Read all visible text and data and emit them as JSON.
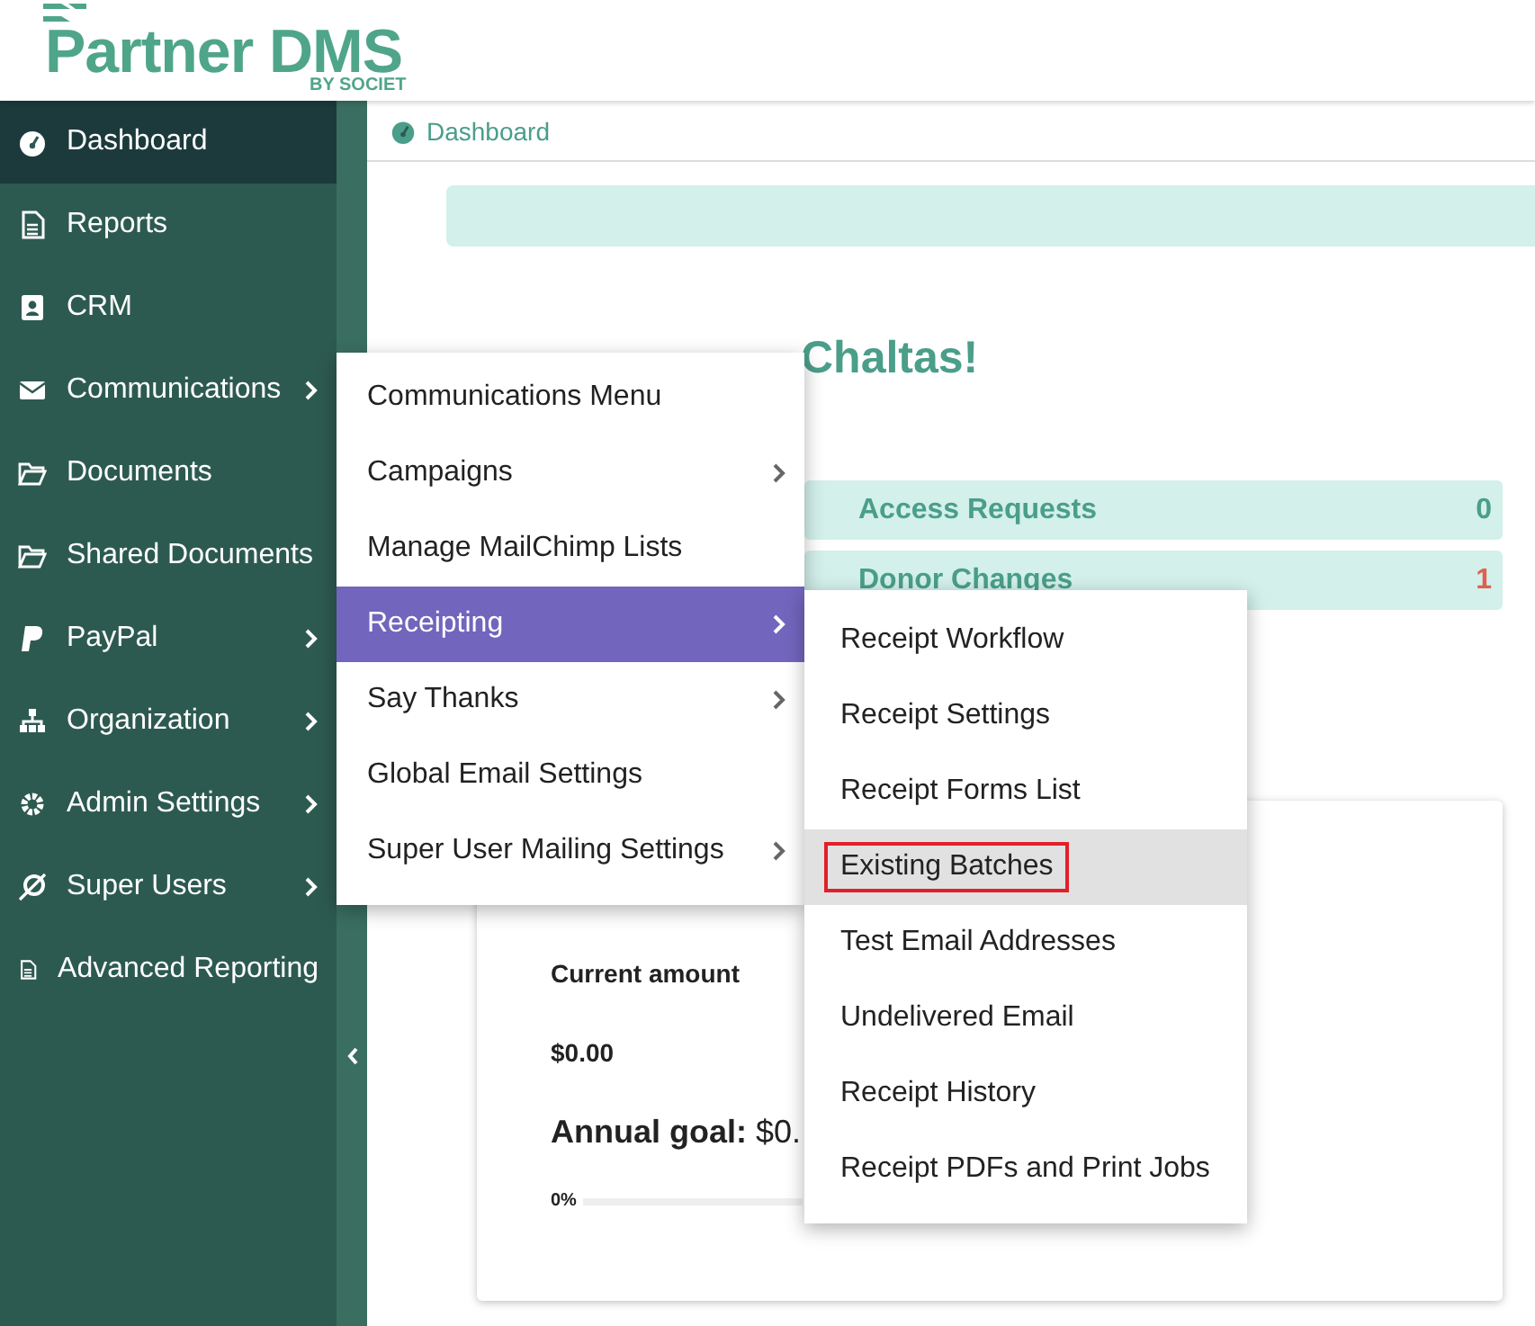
{
  "logo": {
    "name": "Partner DMS",
    "tagline": "BY SOCIET"
  },
  "sidebar": {
    "items": [
      {
        "label": "Dashboard",
        "selected": true,
        "has_submenu": false
      },
      {
        "label": "Reports",
        "selected": false,
        "has_submenu": false
      },
      {
        "label": "CRM",
        "selected": false,
        "has_submenu": false
      },
      {
        "label": "Communications",
        "selected": false,
        "has_submenu": true
      },
      {
        "label": "Documents",
        "selected": false,
        "has_submenu": false
      },
      {
        "label": "Shared Documents",
        "selected": false,
        "has_submenu": false
      },
      {
        "label": "PayPal",
        "selected": false,
        "has_submenu": true
      },
      {
        "label": "Organization",
        "selected": false,
        "has_submenu": true
      },
      {
        "label": "Admin Settings",
        "selected": false,
        "has_submenu": true
      },
      {
        "label": "Super Users",
        "selected": false,
        "has_submenu": true
      },
      {
        "label": "Advanced Reporting",
        "selected": false,
        "has_submenu": false
      }
    ]
  },
  "breadcrumb": "Dashboard",
  "welcome": "Chaltas!",
  "stats": [
    {
      "label": "Access Requests",
      "count": "0",
      "color": "#4a9e8a"
    },
    {
      "label": "Donor Changes",
      "count": "1",
      "color": "#e0604f"
    }
  ],
  "account_card": {
    "current_label": "Current amount",
    "current_value": "$0.00",
    "annual_goal": "**Annual goal:** $0.",
    "progress_label": "0%",
    "level": 0
  },
  "communications_menu": {
    "items": [
      {
        "label": "Communications Menu",
        "selected": false,
        "has_submenu": false
      },
      {
        "label": "Campaigns",
        "selected": false,
        "has_submenu": true
      },
      {
        "label": "Manage MailChimp Lists",
        "selected": false,
        "has_submenu": false
      },
      {
        "label": "Receipting",
        "selected": true,
        "has_submenu": true
      },
      {
        "label": "Say Thanks",
        "selected": false,
        "has_submenu": true
      },
      {
        "label": "Global Email Settings",
        "selected": false,
        "has_submenu": false
      },
      {
        "label": "Super User Mailing Settings",
        "selected": false,
        "has_submenu": true
      }
    ]
  },
  "receipting_menu": {
    "items": [
      {
        "label": "Receipt Workflow",
        "selected": false,
        "outlined": false
      },
      {
        "label": "Receipt Settings",
        "selected": false,
        "outlined": false
      },
      {
        "label": "Receipt Forms List",
        "selected": false,
        "outlined": false
      },
      {
        "label": "Existing Batches",
        "selected": true,
        "outlined": true
      },
      {
        "label": "Test Email Addresses",
        "selected": false,
        "outlined": false
      },
      {
        "label": "Undelivered Email",
        "selected": false,
        "outlined": false
      },
      {
        "label": "Receipt History",
        "selected": false,
        "outlined": false
      },
      {
        "label": "Receipt PDFs and Print Jobs",
        "selected": false,
        "outlined": false
      }
    ]
  }
}
